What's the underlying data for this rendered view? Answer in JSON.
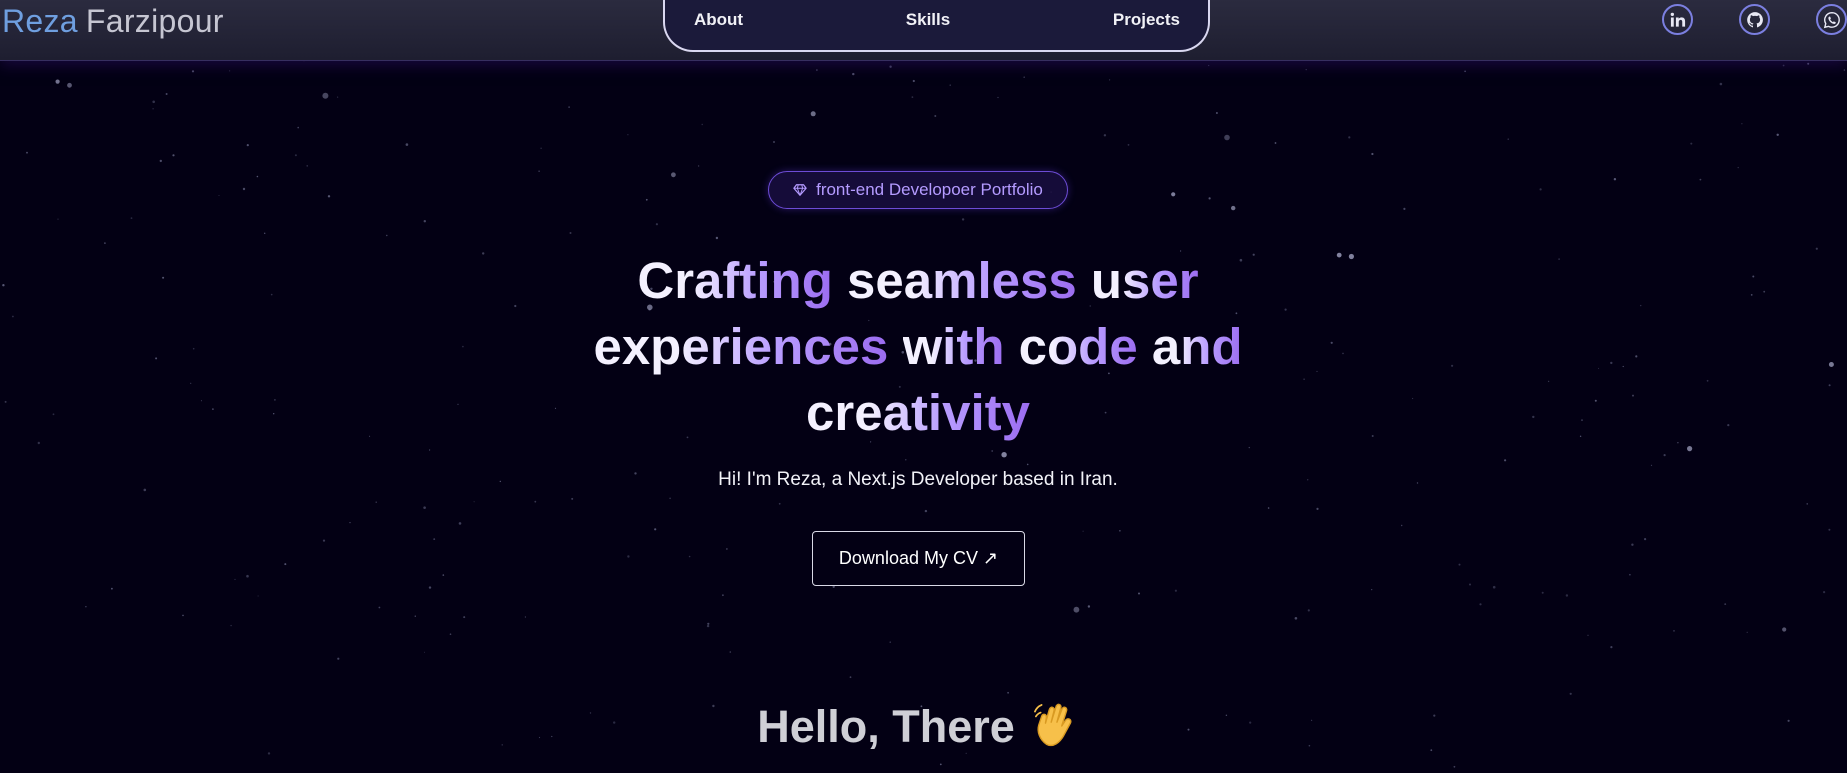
{
  "brand": {
    "first": "Reza",
    "last": "Farzipour"
  },
  "nav": {
    "items": [
      "About",
      "Skills",
      "Projects"
    ]
  },
  "socials": [
    {
      "name": "LinkedIn",
      "icon": "linkedin-icon"
    },
    {
      "name": "GitHub",
      "icon": "github-icon"
    },
    {
      "name": "WhatsApp",
      "icon": "whatsapp-icon"
    }
  ],
  "hero": {
    "badge": "front-end Developoer Portfolio",
    "badge_icon": "gem-icon",
    "headline_lines": [
      [
        "Crafting",
        "seamless",
        "user"
      ],
      [
        "experiences",
        "with",
        "code",
        "and"
      ],
      [
        "creativity"
      ]
    ],
    "subtitle": "Hi! I'm Reza, a Next.js Developer based in Iran.",
    "cv_button": "Download My CV ↗",
    "hello": "Hello, There"
  },
  "colors": {
    "background": "#030014",
    "accent_purple": "#9b6cf0",
    "accent_blue": "#6f9fe0",
    "badge_text": "#b49bff",
    "icon_ring": "#7b7fe0"
  }
}
